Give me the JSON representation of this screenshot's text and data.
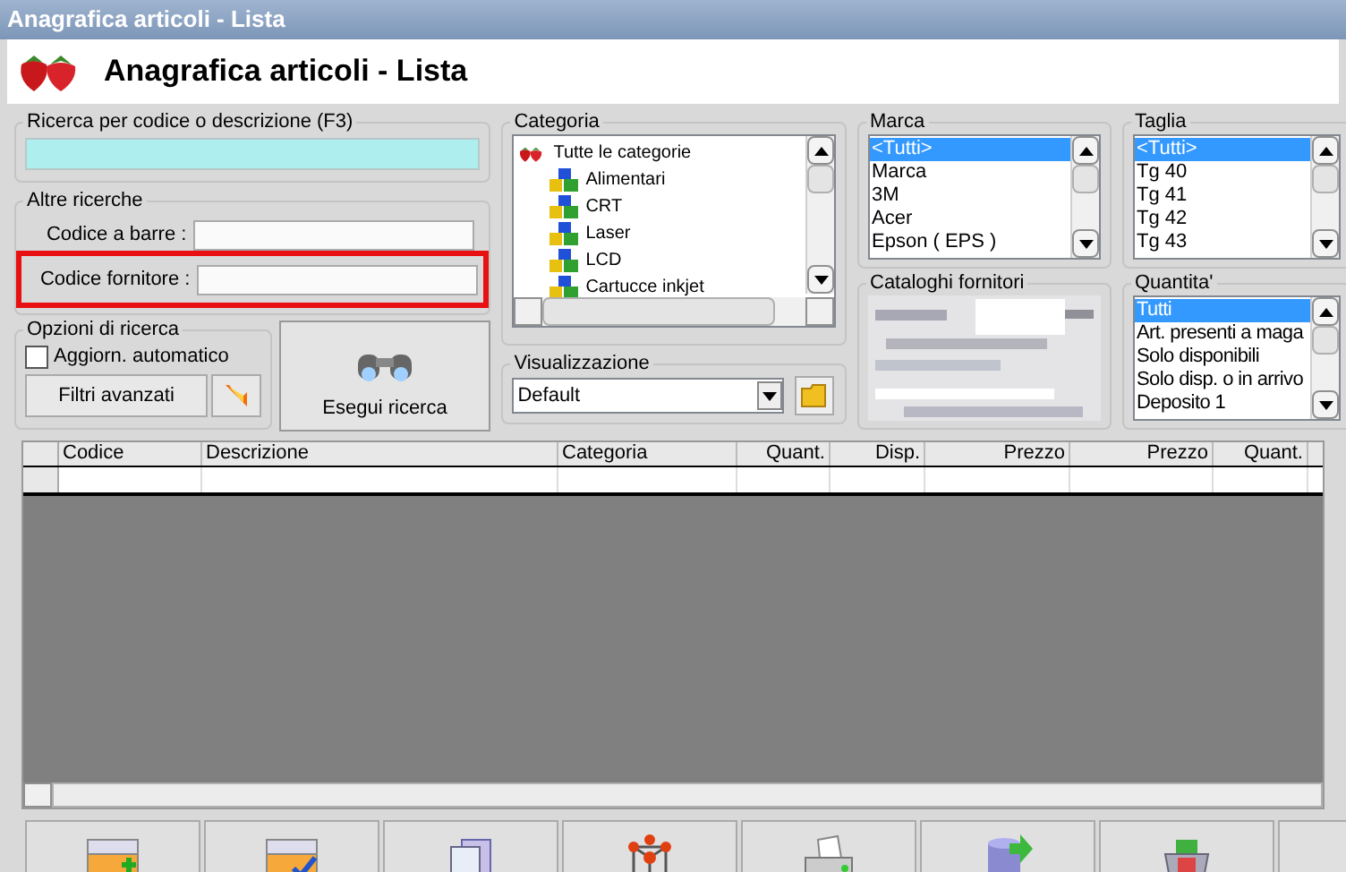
{
  "window": {
    "title": "Anagrafica articoli  - Lista"
  },
  "header": {
    "title": "Anagrafica articoli  - Lista"
  },
  "search": {
    "legend": "Ricerca per codice o descrizione (F3)"
  },
  "other_searches": {
    "legend": "Altre ricerche",
    "fields": [
      {
        "label": "Codice a barre :",
        "highlighted": false
      },
      {
        "label": "Codice fornitore :",
        "highlighted": true
      }
    ]
  },
  "options": {
    "legend": "Opzioni di ricerca",
    "auto_update": {
      "label": "Aggiorn. automatico",
      "checked": false
    },
    "advanced_button": "Filtri avanzati"
  },
  "run_button": "Esegui ricerca",
  "category": {
    "legend": "Categoria",
    "root": {
      "label": "Tutte le categorie",
      "expanded": true,
      "children": [
        {
          "label": "Alimentari"
        },
        {
          "label": "CRT"
        },
        {
          "label": "Laser"
        },
        {
          "label": "LCD"
        },
        {
          "label": "Cartucce inkjet"
        }
      ]
    }
  },
  "view": {
    "legend": "Visualizzazione",
    "value": "Default"
  },
  "brand": {
    "legend": "Marca",
    "items": [
      {
        "label": "<Tutti>",
        "selected": true
      },
      {
        "label": "Marca",
        "selected": false
      },
      {
        "label": "3M",
        "selected": false
      },
      {
        "label": "Acer",
        "selected": false
      },
      {
        "label": "Epson ( EPS )",
        "selected": false
      }
    ]
  },
  "catalogs": {
    "legend": "Cataloghi fornitori"
  },
  "size": {
    "legend": "Taglia",
    "items": [
      {
        "label": "<Tutti>",
        "selected": true
      },
      {
        "label": "Tg 40",
        "selected": false
      },
      {
        "label": "Tg 41",
        "selected": false
      },
      {
        "label": "Tg 42",
        "selected": false
      },
      {
        "label": "Tg 43",
        "selected": false
      }
    ]
  },
  "quantity": {
    "legend": "Quantita'",
    "items": [
      {
        "label": "Tutti",
        "selected": true
      },
      {
        "label": "Art. presenti a maga",
        "selected": false
      },
      {
        "label": "Solo disponibili",
        "selected": false
      },
      {
        "label": "Solo disp. o in arrivo",
        "selected": false
      },
      {
        "label": "Deposito 1",
        "selected": false
      }
    ]
  },
  "table": {
    "columns": [
      {
        "label": "Codice",
        "right_aligned": false
      },
      {
        "label": "Descrizione",
        "right_aligned": false
      },
      {
        "label": "Categoria",
        "right_aligned": false
      },
      {
        "label": "Quant.",
        "right_aligned": true
      },
      {
        "label": "Disp.",
        "right_aligned": true
      },
      {
        "label": "Prezzo",
        "right_aligned": true
      },
      {
        "label": "Prezzo",
        "right_aligned": true
      },
      {
        "label": "Quant.",
        "right_aligned": true
      }
    ]
  },
  "toolbar": [
    {
      "kind": "grid-add"
    },
    {
      "kind": "grid-check"
    },
    {
      "kind": "documents"
    },
    {
      "kind": "lattice"
    },
    {
      "kind": "printer"
    },
    {
      "kind": "database"
    },
    {
      "kind": "cart"
    },
    {
      "kind": "blank"
    }
  ]
}
